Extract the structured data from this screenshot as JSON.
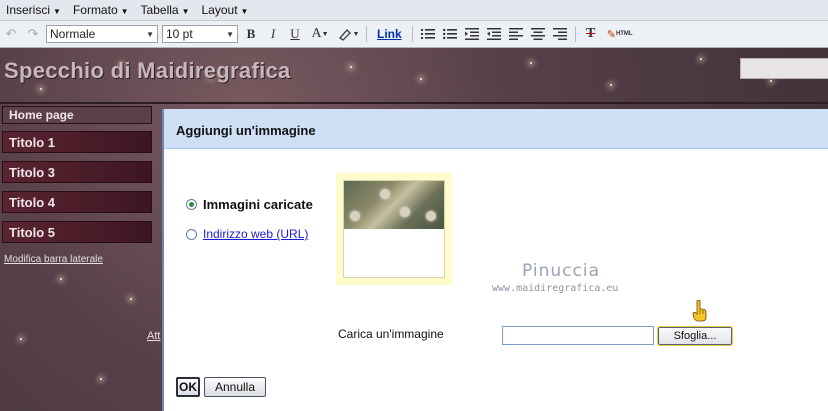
{
  "menubar": {
    "items": [
      "Inserisci",
      "Formato",
      "Tabella",
      "Layout"
    ]
  },
  "toolbar": {
    "style_select": "Normale",
    "size_select": "10 pt",
    "bold": "B",
    "italic": "I",
    "underline": "U",
    "font_color": "A",
    "link": "Link",
    "remove_format": "T",
    "html": "HTML"
  },
  "blog": {
    "title": "Specchio di Maidiregrafica",
    "sidebar": [
      "Home page",
      "Titolo 1",
      "Titolo 3",
      "Titolo 4",
      "Titolo 5"
    ],
    "sidebar_edit_link": "Modifica barra laterale",
    "partial_link": "Att"
  },
  "dialog": {
    "title": "Aggiungi un'immagine",
    "radio_uploaded": "Immagini caricate",
    "radio_url": "Indirizzo web (URL)",
    "watermark_name": "Pinuccia",
    "watermark_url": "www.maidiregrafica.eu",
    "upload_label": "Carica un'immagine",
    "file_input_value": "",
    "browse_button": "Sfoglia...",
    "ok_button": "OK",
    "cancel_button": "Annulla"
  },
  "colors": {
    "dialog_header": "#cfe0f6",
    "sidebar_bg": "#4d1f2c",
    "thumbnail_frame": "#fffbcc",
    "link_color": "#1a1ad0"
  }
}
